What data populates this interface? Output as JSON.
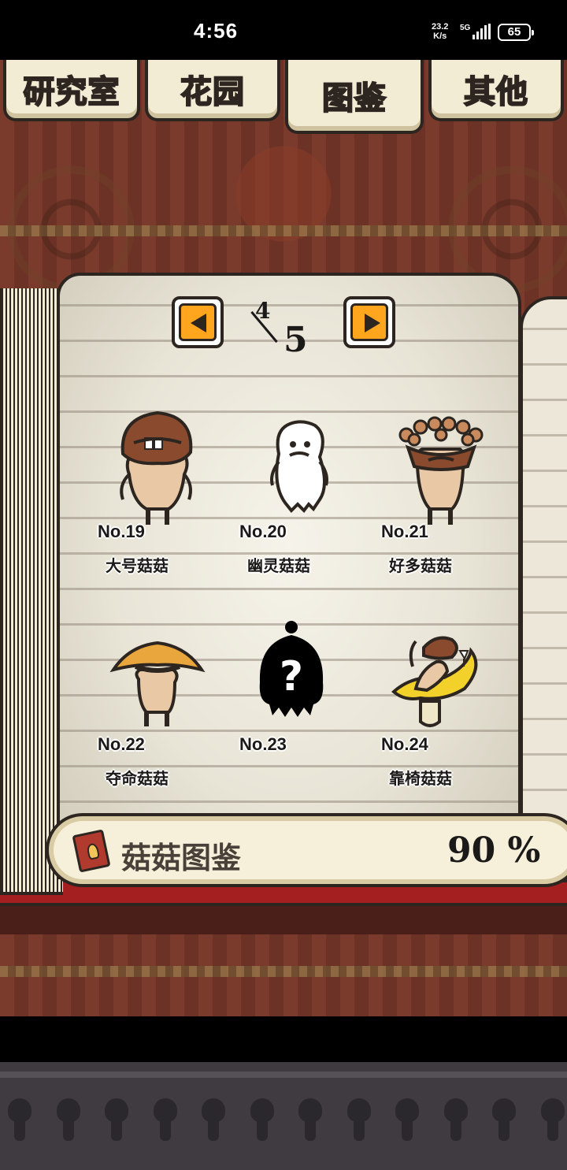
{
  "status_bar": {
    "time": "4:56",
    "speed_value": "23.2",
    "speed_unit": "K/s",
    "network": "5G",
    "battery": "65"
  },
  "tabs": [
    {
      "label": "研究室",
      "active": false
    },
    {
      "label": "花园",
      "active": false
    },
    {
      "label": "图鉴",
      "active": true
    },
    {
      "label": "其他",
      "active": false
    }
  ],
  "pager": {
    "current": "4",
    "total": "5",
    "prev_icon": "arrow-left-icon",
    "next_icon": "arrow-right-icon"
  },
  "entries": [
    {
      "no": "No.19",
      "name": "大号菇菇",
      "icon": "big-mushroom-character"
    },
    {
      "no": "No.20",
      "name": "幽灵菇菇",
      "icon": "ghost-mushroom-character"
    },
    {
      "no": "No.21",
      "name": "好多菇菇",
      "icon": "many-mushrooms-character"
    },
    {
      "no": "No.22",
      "name": "夺命菇菇",
      "icon": "deadly-mushroom-character"
    },
    {
      "no": "No.23",
      "name": "",
      "icon": "unknown-silhouette"
    },
    {
      "no": "No.24",
      "name": "靠椅菇菇",
      "icon": "lounge-chair-mushroom-character"
    }
  ],
  "collection": {
    "title": "菇菇图鉴",
    "percent": "90 %",
    "progress": 0.9,
    "icon": "encyclopedia-book-icon"
  },
  "colors": {
    "accent": "#ffa51e",
    "tab_active_text": "#ffd21f",
    "outline": "#2d2520",
    "paper": "#f3ecd5",
    "book_red": "#a41f20"
  }
}
